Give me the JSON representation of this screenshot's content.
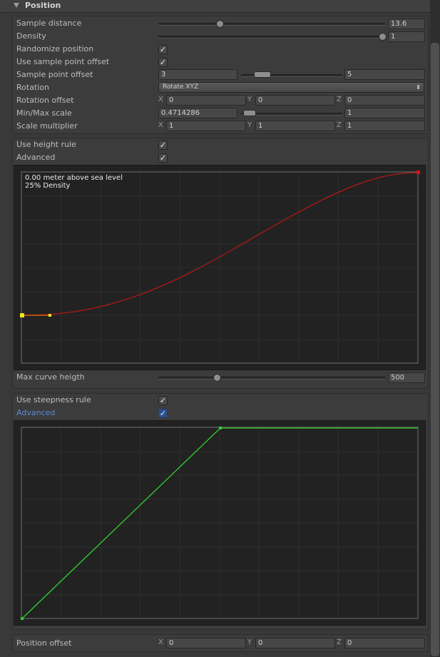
{
  "section": {
    "title": "Position"
  },
  "rows": {
    "sample_distance": {
      "label": "Sample distance",
      "value": "13.6",
      "level": 0.155
    },
    "density": {
      "label": "Density",
      "value": "1",
      "level": 1.0
    },
    "randomize_position": {
      "label": "Randomize position",
      "checked": true
    },
    "use_sample_point_offset": {
      "label": "Use sample point offset",
      "checked": true
    },
    "sample_point_offset": {
      "label": "Sample point offset",
      "min": "3",
      "max": "5"
    },
    "rotation": {
      "label": "Rotation",
      "value": "Rotate XYZ"
    },
    "rotation_offset": {
      "label": "Rotation offset",
      "x": "0",
      "y": "0",
      "z": "0"
    },
    "min_max_scale": {
      "label": "Min/Max scale",
      "min": "0.4714286",
      "max": "1"
    },
    "scale_multiplier": {
      "label": "Scale multiplier",
      "x": "1",
      "y": "1",
      "z": "1"
    },
    "use_height_rule": {
      "label": "Use height rule",
      "checked": true
    },
    "height_advanced": {
      "label": "Advanced",
      "checked": true
    },
    "max_curve_height": {
      "label": "Max curve heigth",
      "value": "500",
      "level": 0.26
    },
    "use_steepness_rule": {
      "label": "Use steepness rule",
      "checked": true
    },
    "steepness_advanced": {
      "label": "Advanced",
      "checked": true
    },
    "position_offset": {
      "label": "Position offset",
      "x": "0",
      "y": "0",
      "z": "0"
    }
  },
  "axis_labels": {
    "x": "X",
    "y": "Y",
    "z": "Z"
  },
  "height_curve": {
    "readout_line1": "0.00 meter above sea level",
    "readout_line2": "25% Density",
    "curve_color": "#b01818",
    "key_color_start": "#f0e020",
    "key_color_end": "#e01010"
  },
  "steepness_curve": {
    "curve_color": "#30d030"
  },
  "colors": {
    "background": "#393939",
    "field": "#474747",
    "curve_bg": "#222222",
    "grid": "#333333",
    "accent_label": "#5b8ad8"
  }
}
